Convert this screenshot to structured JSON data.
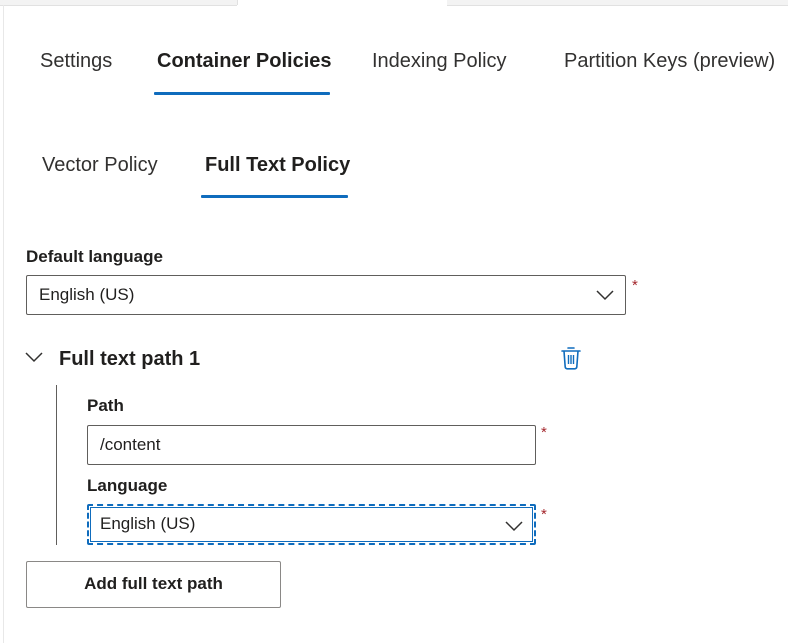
{
  "tabs": [
    {
      "label": "Settings",
      "active": false
    },
    {
      "label": "Container Policies",
      "active": true
    },
    {
      "label": "Indexing Policy",
      "active": false
    },
    {
      "label": "Partition Keys (preview)",
      "active": false
    }
  ],
  "subtabs": [
    {
      "label": "Vector Policy",
      "active": false
    },
    {
      "label": "Full Text Policy",
      "active": true
    }
  ],
  "default_language": {
    "label": "Default language",
    "value": "English (US)",
    "required_mark": "*"
  },
  "full_text_path": {
    "title": "Full text path 1",
    "path_label": "Path",
    "path_value": "/content",
    "language_label": "Language",
    "language_value": "English (US)",
    "required_mark": "*"
  },
  "add_button": {
    "label": "Add full text path"
  },
  "colors": {
    "accent": "#0f6cbd",
    "required": "#a4262c",
    "text": "#323130",
    "border": "#605e5c"
  }
}
